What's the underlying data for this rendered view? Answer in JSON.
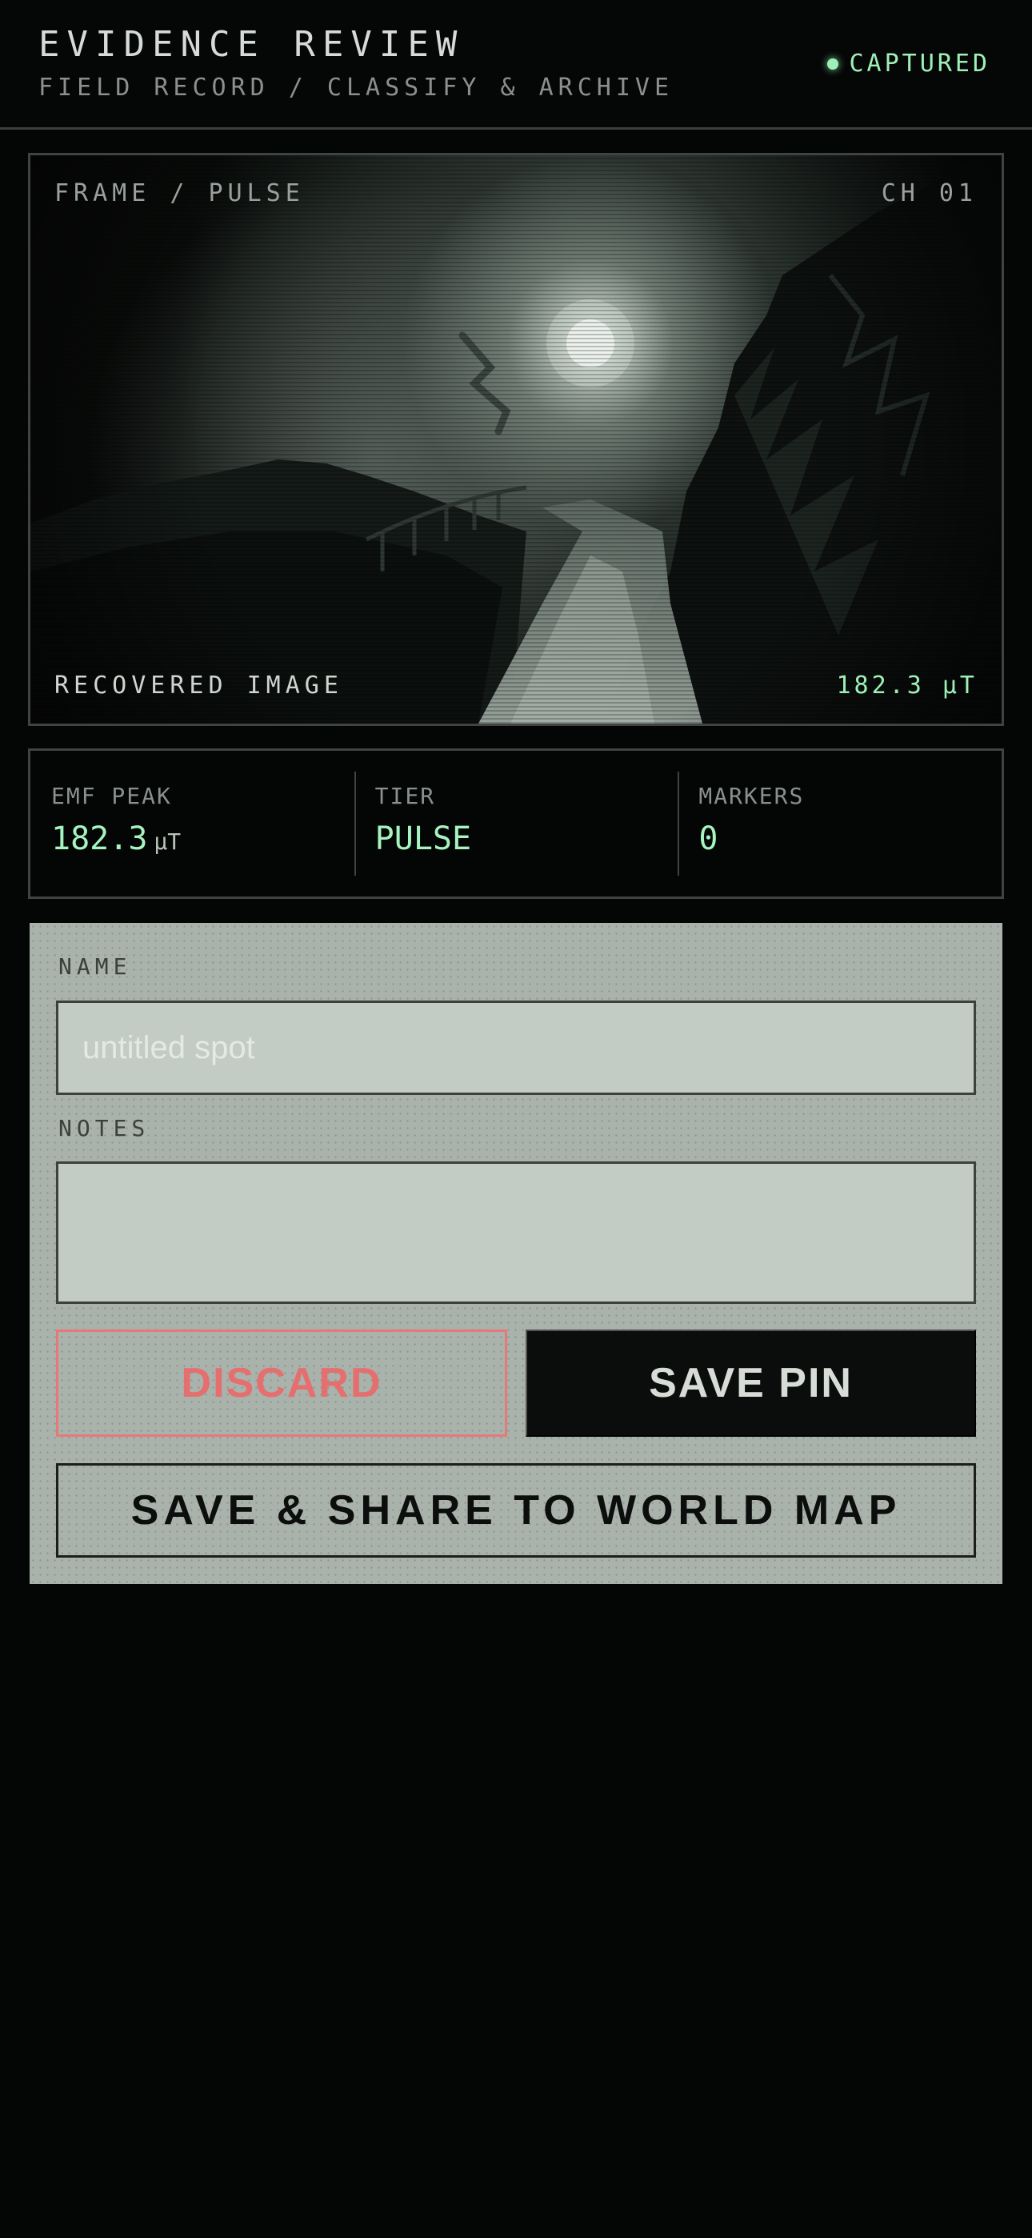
{
  "header": {
    "title": "EVIDENCE REVIEW",
    "subtitle": "FIELD RECORD / CLASSIFY & ARCHIVE",
    "status": "CAPTURED"
  },
  "frame": {
    "top_left": "FRAME / PULSE",
    "top_right": "CH 01",
    "bottom_left": "RECOVERED IMAGE",
    "bottom_right": "182.3 μT"
  },
  "stats": [
    {
      "label": "EMF PEAK",
      "value": "182.3",
      "unit": "μT"
    },
    {
      "label": "TIER",
      "value": "PULSE"
    },
    {
      "label": "MARKERS",
      "value": "0"
    }
  ],
  "form": {
    "name_label": "NAME",
    "name_placeholder": "untitled spot",
    "name_value": "",
    "notes_label": "NOTES",
    "notes_value": "",
    "discard_label": "DISCARD",
    "save_label": "SAVE PIN",
    "share_label": "SAVE & SHARE TO WORLD MAP"
  },
  "colors": {
    "accent_green": "#9ff0b8",
    "discard_red": "#e56f6f",
    "panel": "#a9b2ab",
    "background": "#040505"
  }
}
